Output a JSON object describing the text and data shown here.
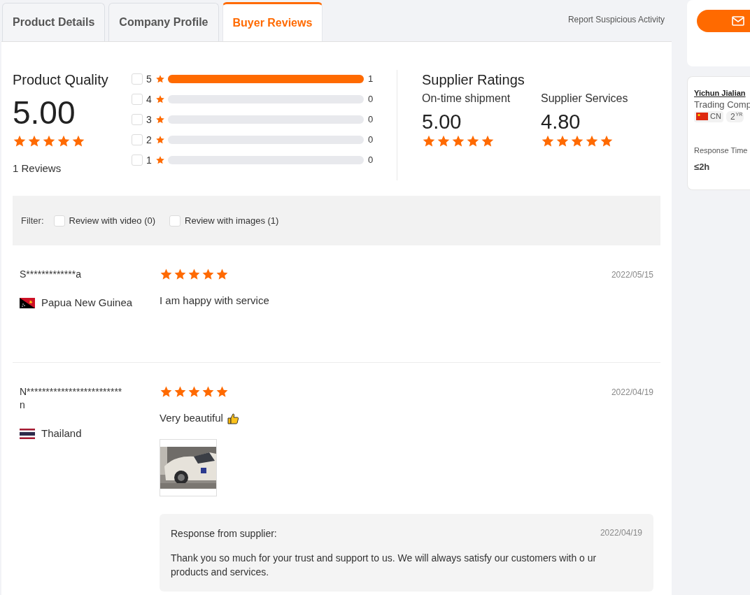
{
  "tabs": [
    {
      "label": "Product Details",
      "selected": false
    },
    {
      "label": "Company Profile",
      "selected": false
    },
    {
      "label": "Buyer Reviews",
      "selected": true
    }
  ],
  "report_link": "Report Suspicious Activity",
  "product_quality": {
    "title": "Product Quality",
    "score": "5.00",
    "stars": 5,
    "reviews": "1 Reviews"
  },
  "rating_breakdown": [
    {
      "label": "5",
      "checked": false,
      "level": 1,
      "count": "1"
    },
    {
      "label": "4",
      "checked": false,
      "level": 0,
      "count": "0"
    },
    {
      "label": "3",
      "checked": false,
      "level": 0,
      "count": "0"
    },
    {
      "label": "2",
      "checked": false,
      "level": 0,
      "count": "0"
    },
    {
      "label": "1",
      "checked": false,
      "level": 0,
      "count": "0"
    }
  ],
  "supplier_ratings": {
    "title": "Supplier Ratings",
    "items": [
      {
        "label": "On-time shipment",
        "score": "5.00",
        "stars": 5
      },
      {
        "label": "Supplier Services",
        "score": "4.80",
        "stars": 5
      }
    ]
  },
  "filter": {
    "label": "Filter:",
    "options": [
      {
        "label": "Review with video (0)",
        "checked": false
      },
      {
        "label": "Review with images (1)",
        "checked": false
      }
    ]
  },
  "reviews": [
    {
      "name": "S*************a",
      "country": "Papua New Guinea",
      "stars": 5,
      "date": "2022/05/15",
      "text": "I am happy with service"
    },
    {
      "name": "N*************************n",
      "country": "Thailand",
      "stars": 5,
      "date": "2022/04/19",
      "text": "Very beautiful",
      "thumbs_up": true,
      "photos": [
        {
          "kind": "picture"
        }
      ],
      "response": {
        "title": "Response from supplier:",
        "date": "2022/04/19",
        "text": "Thank you so much for your trust and support to us. We will always satisfy our customers with o ur products and services."
      }
    }
  ],
  "sidebar": {
    "company_name": "Yichun Jialian",
    "company_type": "Trading Comp",
    "country": "CN",
    "years": "2",
    "years_unit": "YR",
    "response_label": "Response Time",
    "response_value": "≤2h"
  }
}
